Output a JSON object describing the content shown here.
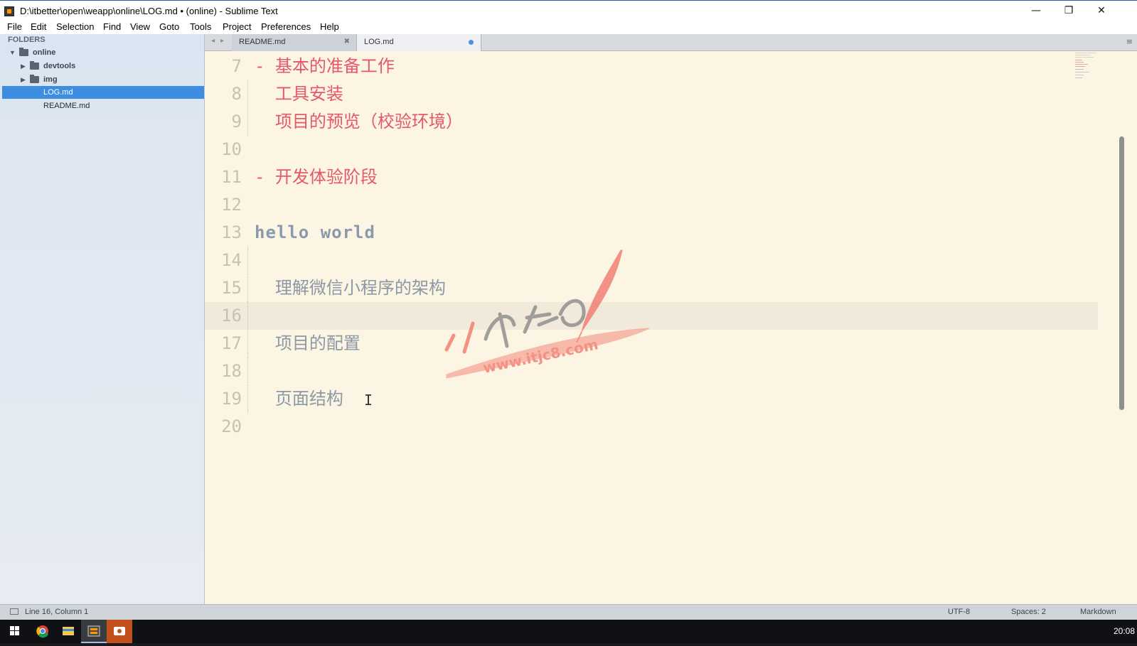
{
  "window": {
    "title": "D:\\itbetter\\open\\weapp\\online\\LOG.md • (online) - Sublime Text",
    "minimize_glyph": "—",
    "restore_glyph": "❐",
    "close_glyph": "✕"
  },
  "menu": [
    "File",
    "Edit",
    "Selection",
    "Find",
    "View",
    "Goto",
    "Tools",
    "Project",
    "Preferences",
    "Help"
  ],
  "sidebar": {
    "header": "FOLDERS",
    "root": "online",
    "items": [
      {
        "label": "devtools",
        "type": "folder"
      },
      {
        "label": "img",
        "type": "folder"
      },
      {
        "label": "LOG.md",
        "type": "file",
        "selected": true
      },
      {
        "label": "README.md",
        "type": "file"
      }
    ]
  },
  "tabs": {
    "nav_left": "◂",
    "nav_right": "▸",
    "items": [
      {
        "label": "README.md",
        "close": "✖"
      },
      {
        "label": "LOG.md",
        "dirty": true
      }
    ],
    "menu_glyph": "≡"
  },
  "editor": {
    "lines": [
      {
        "num": "7",
        "text": "- 基本的准备工作",
        "style": "red"
      },
      {
        "num": "8",
        "text": "  工具安装",
        "style": "red"
      },
      {
        "num": "9",
        "text": "  项目的预览（校验环境）",
        "style": "red"
      },
      {
        "num": "10",
        "text": "",
        "style": "plain"
      },
      {
        "num": "11",
        "text": "- 开发体验阶段",
        "style": "red"
      },
      {
        "num": "12",
        "text": "",
        "style": "plain"
      },
      {
        "num": "13",
        "text": "hello world",
        "style": "hello"
      },
      {
        "num": "14",
        "text": "",
        "style": "plain"
      },
      {
        "num": "15",
        "text": "  理解微信小程序的架构",
        "style": "plain"
      },
      {
        "num": "16",
        "text": "",
        "style": "plain",
        "current": true
      },
      {
        "num": "17",
        "text": "  项目的配置",
        "style": "plain"
      },
      {
        "num": "18",
        "text": "",
        "style": "plain"
      },
      {
        "num": "19",
        "text": "  页面结构",
        "style": "plain"
      },
      {
        "num": "20",
        "text": "",
        "style": "plain"
      }
    ],
    "cursor_glyph": "I"
  },
  "watermark": {
    "brand": "IT教程吧",
    "url": "www.itjc8.com",
    "color": "#f07a6e"
  },
  "status": {
    "position": "Line 16, Column 1",
    "encoding": "UTF-8",
    "indent": "Spaces: 2",
    "syntax": "Markdown"
  },
  "taskbar": {
    "clock": "20:08",
    "apps": [
      "windows-start",
      "chrome",
      "file-explorer",
      "sublime-text",
      "recorder"
    ]
  },
  "colors": {
    "accent_selection": "#3d8ee0",
    "markdown_list": "#e4586a",
    "editor_bg": "#fdf5e3"
  }
}
